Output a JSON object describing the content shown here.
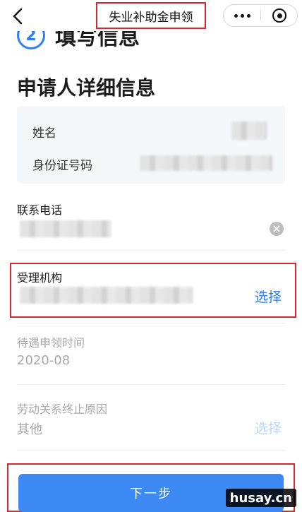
{
  "nav": {
    "title": "失业补助金申领"
  },
  "step": {
    "number": "2",
    "title": "填写信息"
  },
  "section_title": "申请人详细信息",
  "info": {
    "name_label": "姓名",
    "id_label": "身份证号码"
  },
  "fields": {
    "phone": {
      "label": "联系电话"
    },
    "agency": {
      "label": "受理机构",
      "action": "选择"
    },
    "period": {
      "label": "待遇申领时间",
      "value": "2020-08"
    },
    "reason": {
      "label": "劳动关系终止原因",
      "value": "其他",
      "action": "选择"
    }
  },
  "next_button": "下一步",
  "watermark": "husay.cn",
  "colors": {
    "accent": "#2f7ff1",
    "button": "#3e8af4",
    "annotation_red": "#d8272e"
  }
}
